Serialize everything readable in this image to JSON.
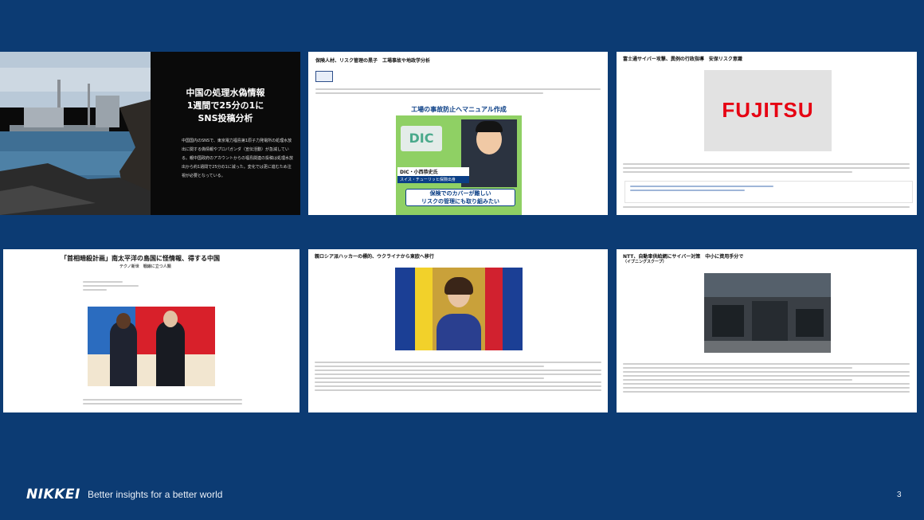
{
  "cards": {
    "c1": {
      "headline": [
        "中国の処理水偽情報",
        "1週間で25分の1に",
        "SNS投稿分析"
      ],
      "body": "中国国内のSNSで、東京電力福島第1原子力発電所の処理水放出に関する偽情報やプロパガンダ（宣伝活動）が急減している。親中国政府のアカウントからの福島関連の投稿は処理水放出から約1週間で25分の1に減った。変化では更に進むため注視が必要となっている。"
    },
    "c2": {
      "title": "保険人材、リスク管理の黒子　工場事故や地政学分析",
      "video_text": "工場の事故防止へマニュアル作成",
      "sign_text": "DIC",
      "name_caption_1": "DIC・小西恭史氏",
      "name_caption_2": "スイス・チューリッヒ保険出身",
      "quote_1": "保険でのカバーが難しい",
      "quote_2": "リスクの管理にも取り組みたい"
    },
    "c3": {
      "title": "富士通サイバー攻撃、異例の行政指導　安保リスク意識",
      "logo_text": "FUJITSU"
    },
    "c4": {
      "title": "「首相暗殺計画」南太平洋の島国に怪情報、得する中国",
      "subtitle": "テクノ新世　戦線に立つ人類"
    },
    "c5": {
      "title": "親ロシア派ハッカーの標的、ウクライナから東欧へ移行"
    },
    "c6": {
      "title": "NTT、自動車供給網にサイバー対策　中小に資用手分で",
      "subtitle": "（イブニングスクープ）"
    }
  },
  "footer": {
    "brand": "NIKKEI",
    "tagline": "Better insights for a better world",
    "page_number": "3"
  },
  "colors": {
    "background": "#0c3b73",
    "fujitsu_red": "#e60012"
  }
}
